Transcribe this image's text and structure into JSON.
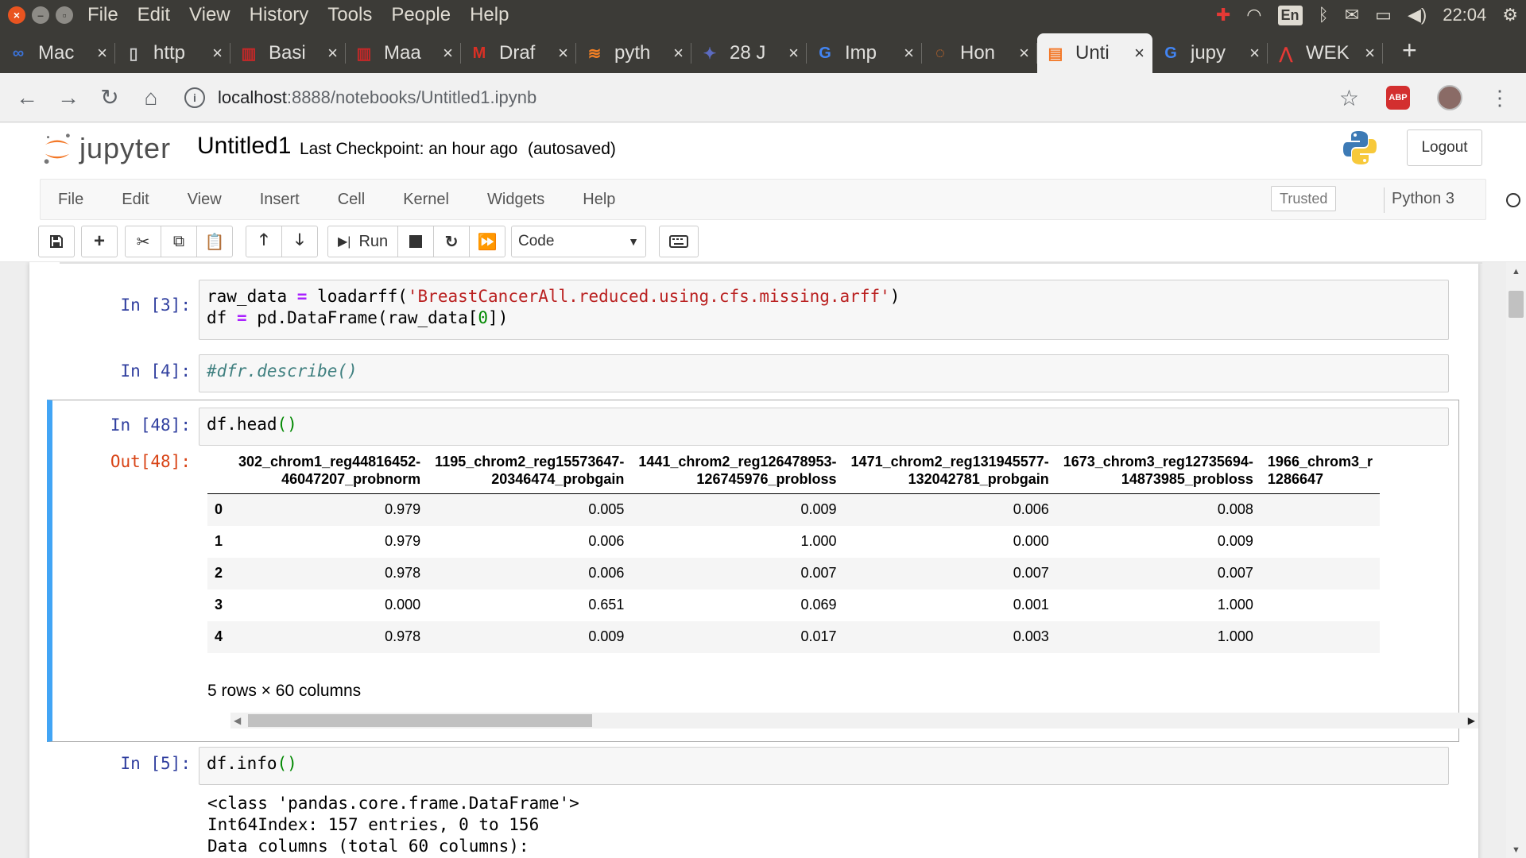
{
  "os": {
    "menu": [
      "File",
      "Edit",
      "View",
      "History",
      "Tools",
      "People",
      "Help"
    ],
    "keyboard_layout": "En",
    "clock": "22:04"
  },
  "tabs": [
    {
      "label": "Mac",
      "icon": "infinity-icon",
      "color": "#3b73d9"
    },
    {
      "label": "http",
      "icon": "page-icon",
      "color": "#cccccc"
    },
    {
      "label": "Basi",
      "icon": "library-icon",
      "color": "#c62828"
    },
    {
      "label": "Maa",
      "icon": "library-icon",
      "color": "#c62828"
    },
    {
      "label": "Draf",
      "icon": "gmail-icon",
      "color": "#d93025"
    },
    {
      "label": "pyth",
      "icon": "stackoverflow-icon",
      "color": "#f48024"
    },
    {
      "label": "28 J",
      "icon": "rocket-icon",
      "color": "#5c6bc0"
    },
    {
      "label": "Imp",
      "icon": "google-icon",
      "color": "#4285f4"
    },
    {
      "label": "Hon",
      "icon": "jupyter-icon",
      "color": "#f37726"
    },
    {
      "label": "Unti",
      "icon": "notebook-icon",
      "color": "#f37726",
      "active": true
    },
    {
      "label": "jupy",
      "icon": "google-icon",
      "color": "#4285f4"
    },
    {
      "label": "WEK",
      "icon": "pdf-icon",
      "color": "#e53935"
    }
  ],
  "address": {
    "host": "localhost",
    "path": ":8888/notebooks/Untitled1.ipynb"
  },
  "jupyter": {
    "logo_text": "jupyter",
    "notebook_name": "Untitled1",
    "checkpoint": "Last Checkpoint: an hour ago",
    "autosave": "(autosaved)",
    "logout": "Logout",
    "menu": [
      "File",
      "Edit",
      "View",
      "Insert",
      "Cell",
      "Kernel",
      "Widgets",
      "Help"
    ],
    "trusted": "Trusted",
    "kernel": "Python 3",
    "run_label": "Run",
    "cell_type": "Code"
  },
  "cells": {
    "c3": {
      "prompt": "In [3]:",
      "line1": {
        "a": "raw_data",
        "op": " = ",
        "b": "loadarff(",
        "str": "'BreastCancerAll.reduced.using.cfs.missing.arff'",
        "c": ")"
      },
      "line2": {
        "a": "df",
        "op": " = ",
        "b": "pd.DataFrame(raw_data[",
        "num": "0",
        "c": "])"
      }
    },
    "c4": {
      "prompt": "In [4]:",
      "code": "#dfr.describe()"
    },
    "c48": {
      "prompt": "In [48]:",
      "code": "df.head",
      "parens": "()",
      "out_prompt": "Out[48]:",
      "columns": [
        [
          "302_chrom1_reg44816452-",
          "46047207_probnorm"
        ],
        [
          "1195_chrom2_reg15573647-",
          "20346474_probgain"
        ],
        [
          "1441_chrom2_reg126478953-",
          "126745976_probloss"
        ],
        [
          "1471_chrom2_reg131945577-",
          "132042781_probgain"
        ],
        [
          "1673_chrom3_reg12735694-",
          "14873985_probloss"
        ],
        [
          "1966_chrom3_r",
          "1286647"
        ]
      ],
      "rows": [
        {
          "idx": "0",
          "vals": [
            "0.979",
            "0.005",
            "0.009",
            "0.006",
            "0.008",
            ""
          ]
        },
        {
          "idx": "1",
          "vals": [
            "0.979",
            "0.006",
            "1.000",
            "0.000",
            "0.009",
            ""
          ]
        },
        {
          "idx": "2",
          "vals": [
            "0.978",
            "0.006",
            "0.007",
            "0.007",
            "0.007",
            ""
          ]
        },
        {
          "idx": "3",
          "vals": [
            "0.000",
            "0.651",
            "0.069",
            "0.001",
            "1.000",
            ""
          ]
        },
        {
          "idx": "4",
          "vals": [
            "0.978",
            "0.009",
            "0.017",
            "0.003",
            "1.000",
            ""
          ]
        }
      ],
      "shape": "5 rows × 60 columns"
    },
    "c5": {
      "prompt": "In [5]:",
      "code": "df.info",
      "parens": "()",
      "output": [
        "<class 'pandas.core.frame.DataFrame'>",
        "Int64Index: 157 entries, 0 to 156",
        "Data columns (total 60 columns):"
      ]
    }
  }
}
